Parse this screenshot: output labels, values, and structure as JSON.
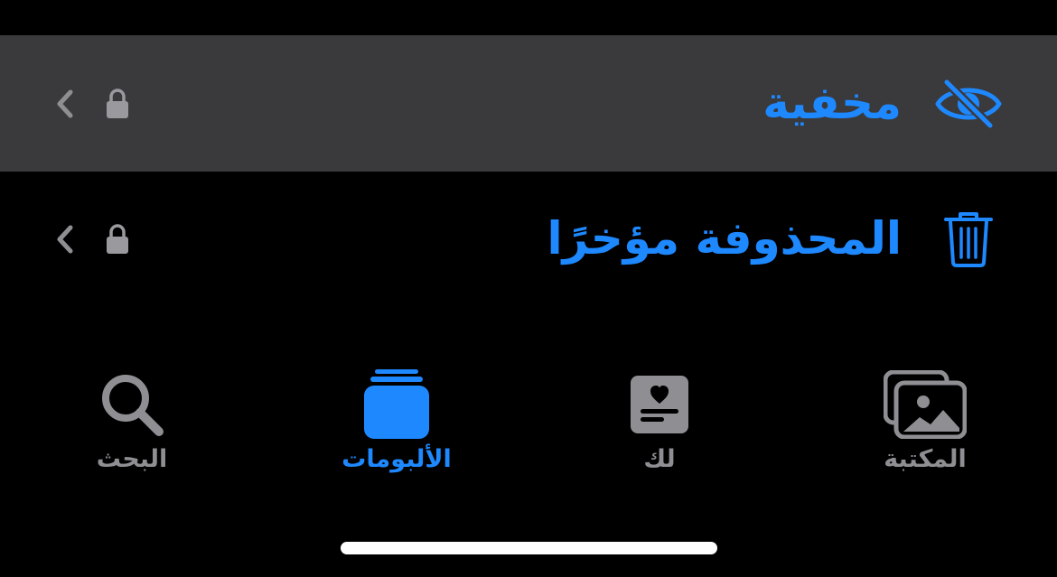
{
  "colors": {
    "accent": "#1e88ff",
    "inactive": "#8e8e93",
    "row_highlight": "#3a3a3c",
    "background": "#000000"
  },
  "rows": [
    {
      "title": "مخفية",
      "icon": "eye-slash-icon",
      "locked": true
    },
    {
      "title": "المحذوفة مؤخرًا",
      "icon": "trash-icon",
      "locked": true
    }
  ],
  "tabs": [
    {
      "label": "المكتبة",
      "icon": "photo-library-icon",
      "active": false
    },
    {
      "label": "لك",
      "icon": "for-you-icon",
      "active": false
    },
    {
      "label": "الألبومات",
      "icon": "albums-icon",
      "active": true
    },
    {
      "label": "البحث",
      "icon": "search-icon",
      "active": false
    }
  ]
}
